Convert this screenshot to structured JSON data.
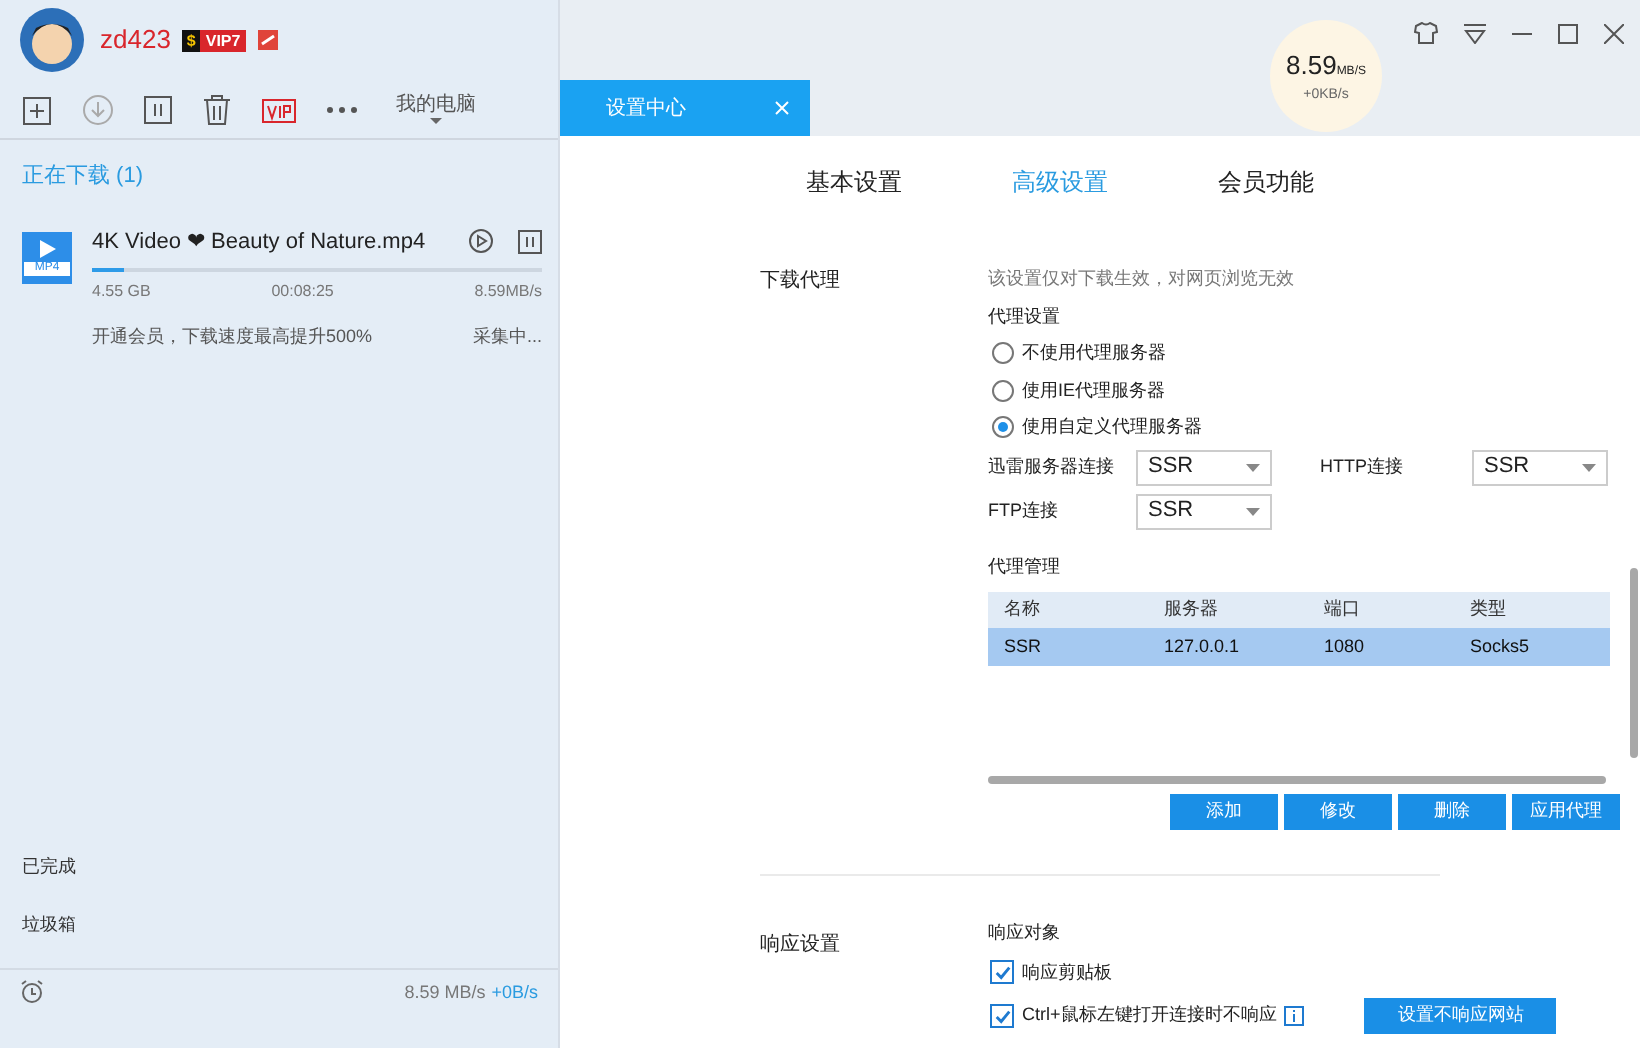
{
  "user": {
    "name": "zd423",
    "badge_prefix": "$",
    "badge": "VIP7"
  },
  "toolbar": {
    "location": "我的电脑"
  },
  "downloading": {
    "header": "正在下载 (1)"
  },
  "task": {
    "file_type": "MP4",
    "name": "4K Video ❤ Beauty of Nature.mp4",
    "level": 0.07,
    "size": "4.55 GB",
    "time": "00:08:25",
    "speed": "8.59MB/s",
    "promo": "开通会员，下载速度最高提升500%",
    "status": "采集中..."
  },
  "sidebar": {
    "items": [
      {
        "label": "已完成"
      },
      {
        "label": "垃圾箱"
      }
    ]
  },
  "footer": {
    "speed": "8.59 MB/s",
    "upload": "+0B/s"
  },
  "speed_meter": {
    "value": "8.59",
    "unit": "MB/S",
    "sub": "+0KB/s"
  },
  "tab": {
    "title": "设置中心"
  },
  "settings_tabs": [
    {
      "label": "基本设置",
      "selected": false
    },
    {
      "label": "高级设置",
      "selected": true
    },
    {
      "label": "会员功能",
      "selected": false
    }
  ],
  "proxy": {
    "label": "下载代理",
    "note": "该设置仅对下载生效，对网页浏览无效",
    "group": "代理设置",
    "options": [
      {
        "label": "不使用代理服务器",
        "selected": false
      },
      {
        "label": "使用IE代理服务器",
        "selected": false
      },
      {
        "label": "使用自定义代理服务器",
        "selected": true
      }
    ],
    "selects": [
      {
        "label": "迅雷服务器连接",
        "value": "SSR"
      },
      {
        "label": "HTTP连接",
        "value": "SSR"
      },
      {
        "label": "FTP连接",
        "value": "SSR"
      }
    ],
    "manage": "代理管理",
    "table": {
      "columns": [
        "名称",
        "服务器",
        "端口",
        "类型"
      ],
      "rows": [
        {
          "cells": [
            "SSR",
            "127.0.0.1",
            "1080",
            "Socks5"
          ],
          "selected": true
        }
      ]
    },
    "buttons": [
      "添加",
      "修改",
      "删除",
      "应用代理"
    ]
  },
  "response": {
    "label": "响应设置",
    "group": "响应对象",
    "options": [
      {
        "label": "响应剪贴板",
        "checked": true,
        "info": false
      },
      {
        "label": "Ctrl+鼠标左键打开连接时不响应",
        "checked": true,
        "info": true
      }
    ],
    "button": "设置不响应网站"
  }
}
